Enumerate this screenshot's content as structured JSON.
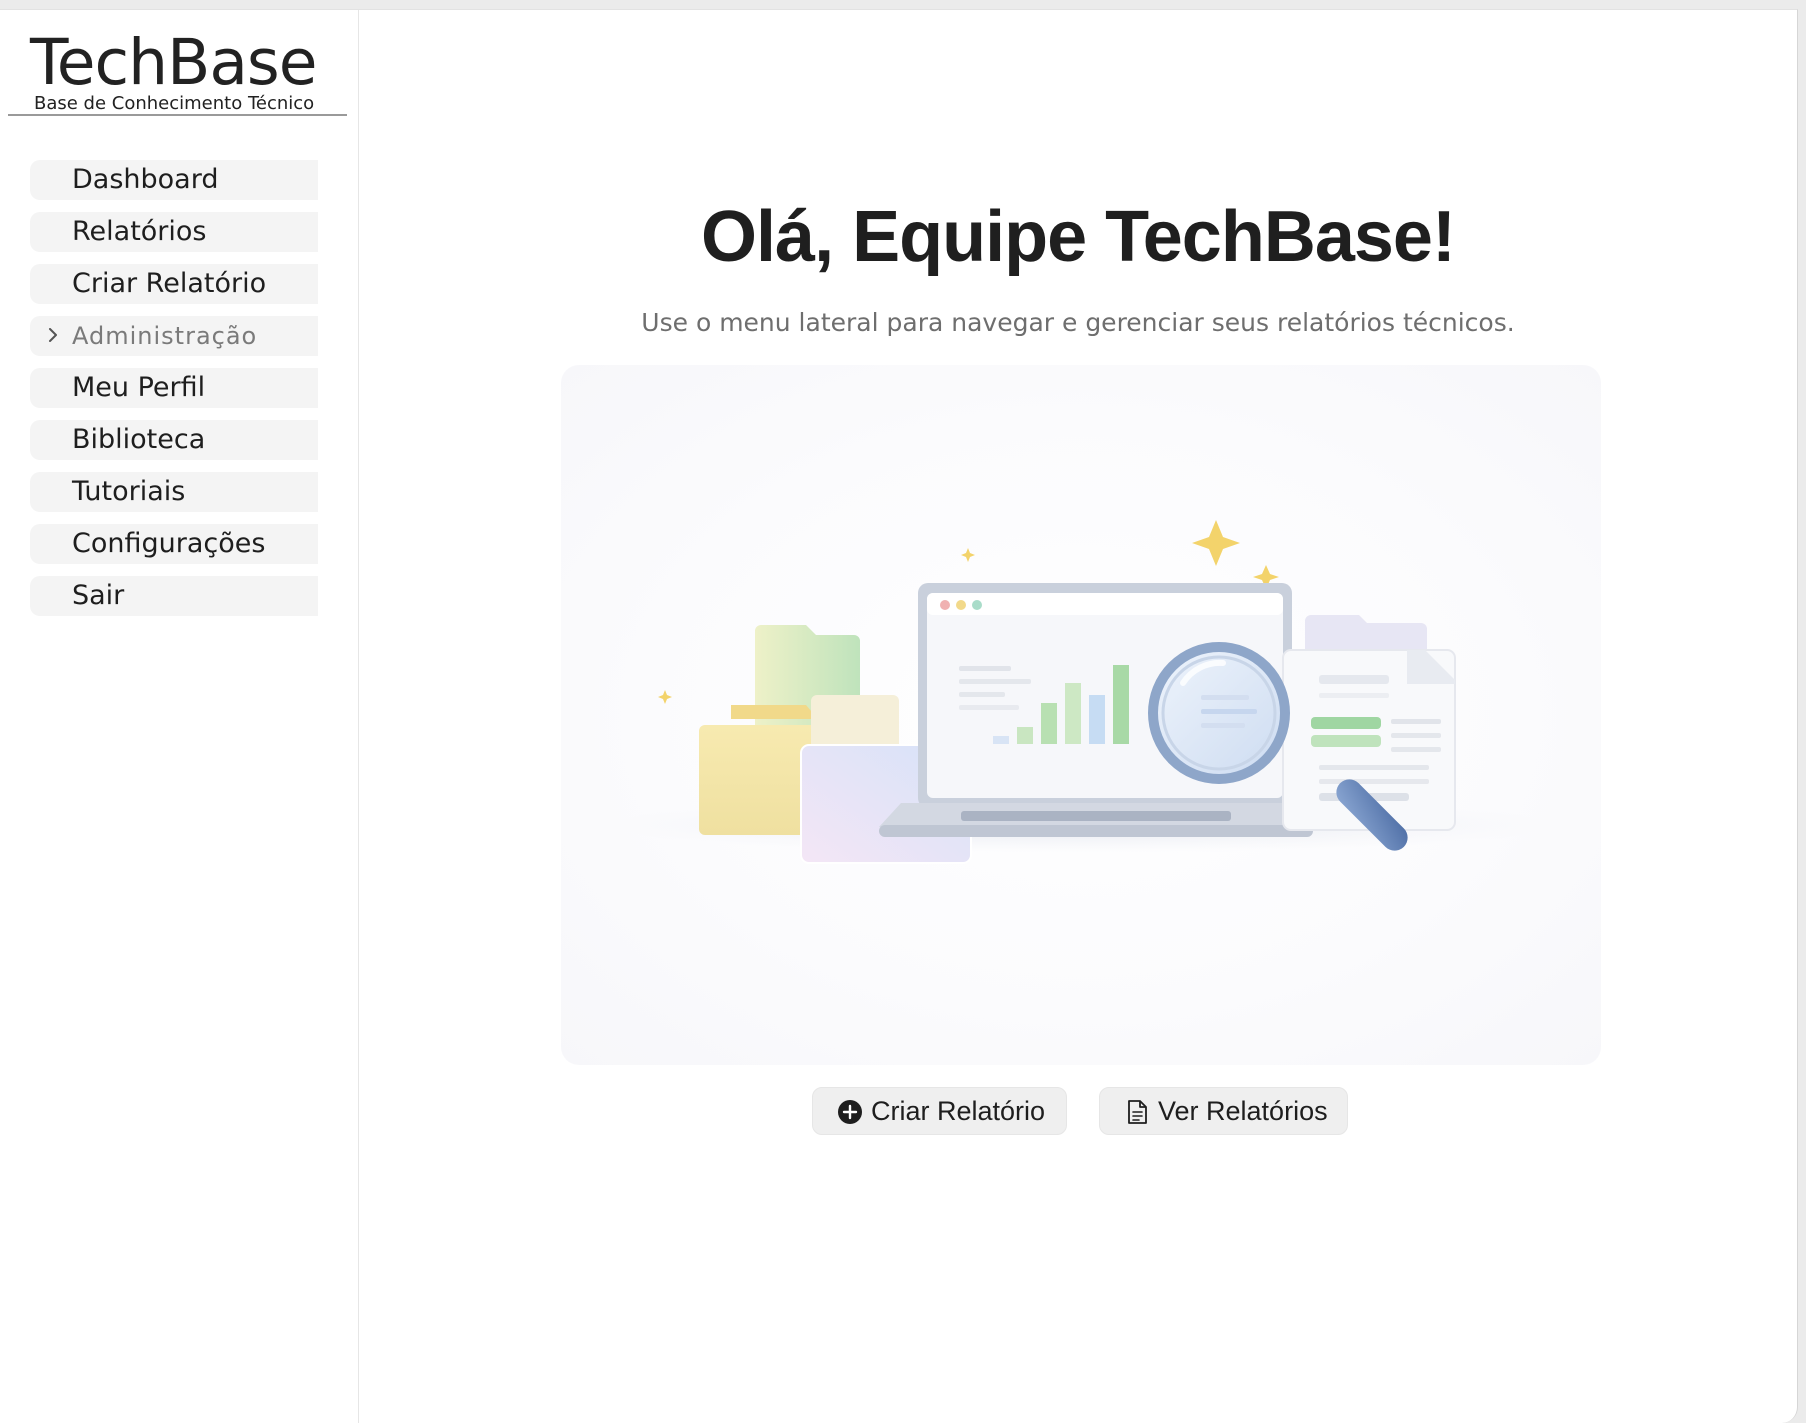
{
  "brand": {
    "title": "TechBase",
    "subtitle": "Base de Conhecimento Técnico"
  },
  "sidebar": {
    "items": [
      {
        "label": "Dashboard"
      },
      {
        "label": "Relatórios"
      },
      {
        "label": "Criar Relatório"
      },
      {
        "label": "Administração",
        "collapsed": true,
        "icon": "chevron-right-icon"
      },
      {
        "label": "Meu Perfil"
      },
      {
        "label": "Biblioteca"
      },
      {
        "label": "Tutoriais"
      },
      {
        "label": "Configurações"
      },
      {
        "label": "Sair"
      }
    ]
  },
  "main": {
    "headline": "Olá, Equipe TechBase!",
    "subline": "Use o menu lateral para navegar e gerenciar seus relatórios técnicos.",
    "illustration": {
      "icon": "reports-analytics-illustration",
      "colors": {
        "yellow": "#f5e7a6",
        "green": "#b9e2b3",
        "blue": "#cfe0f7",
        "lens": "#6f8fbf"
      }
    },
    "actions": {
      "create_label": "Criar Relatório",
      "create_icon": "plus-circle-icon",
      "view_label": "Ver Relatórios",
      "view_icon": "document-icon"
    }
  }
}
